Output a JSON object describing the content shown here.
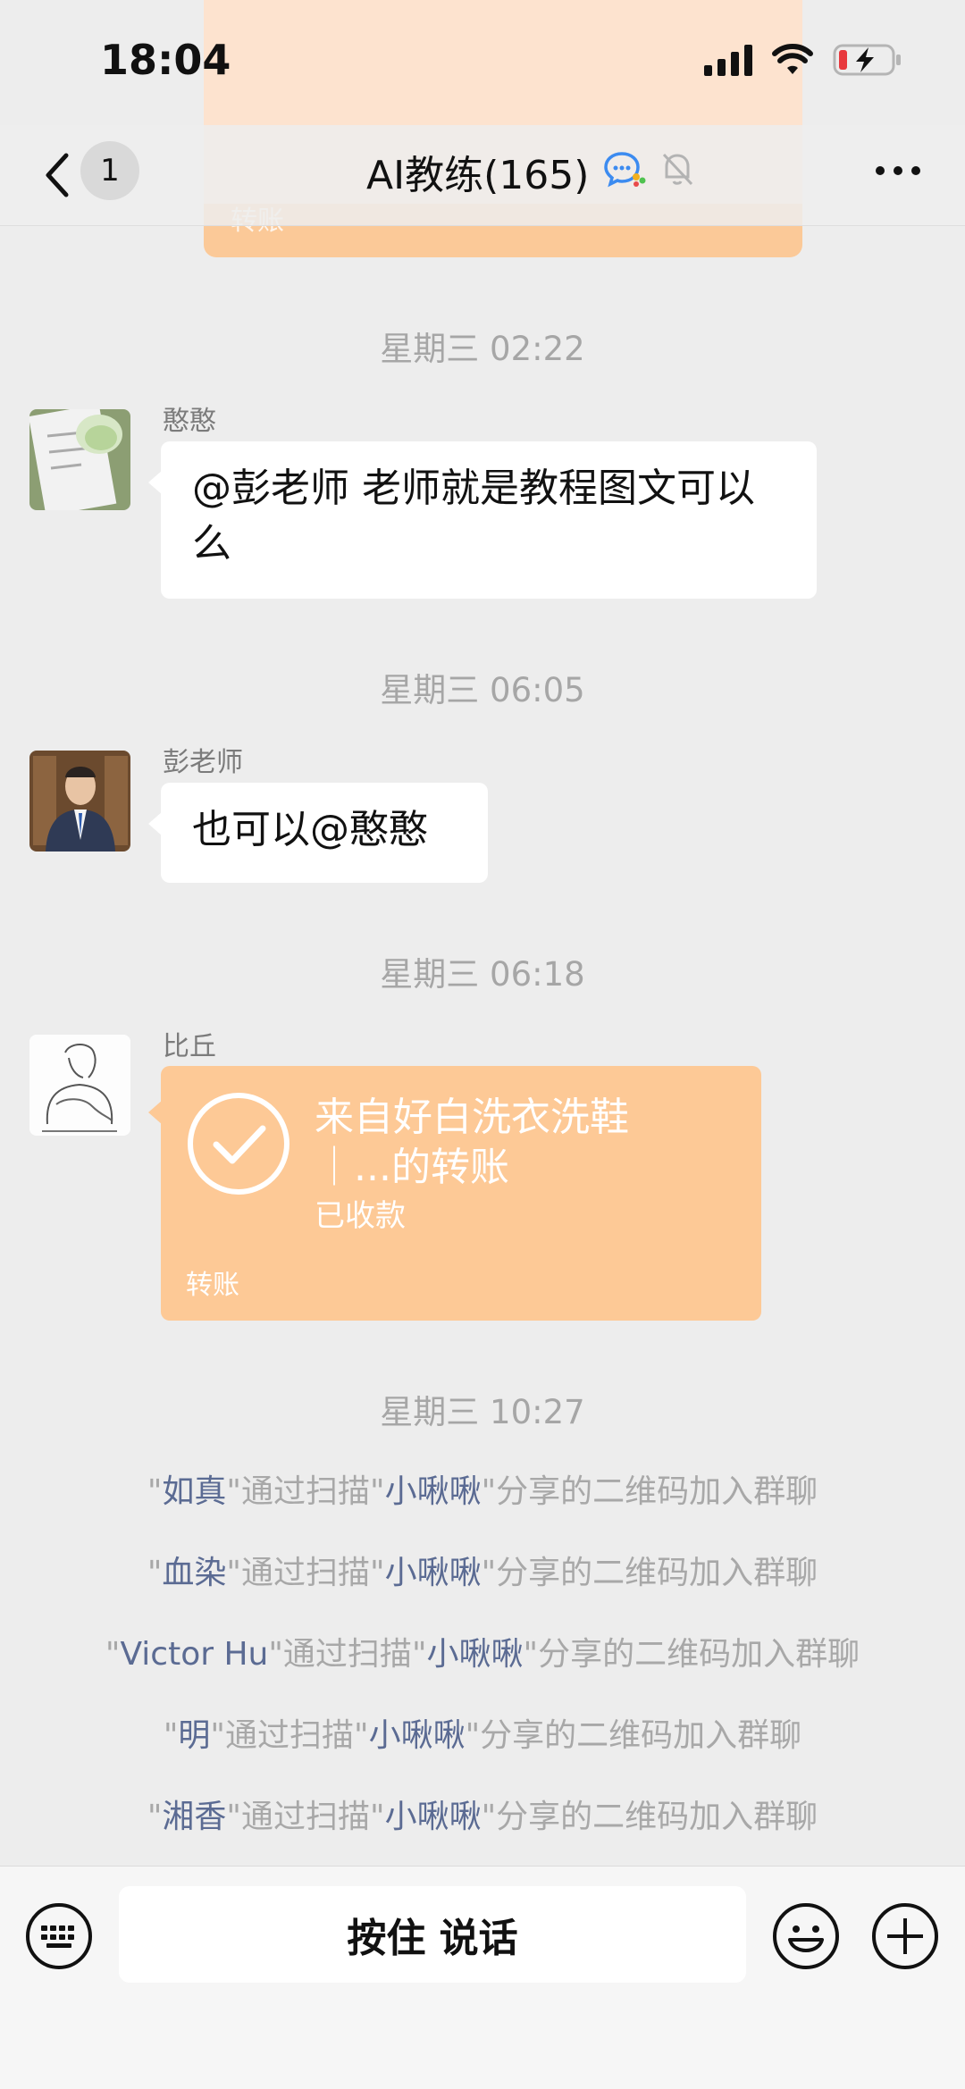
{
  "status_bar": {
    "time": "18:04"
  },
  "header": {
    "back_count": "1",
    "title": "AI教练(165)"
  },
  "background_card_label": "转账",
  "messages": [
    {
      "timestamp": "星期三 02:22",
      "sender": "憨憨",
      "text": "@彭老师 老师就是教程图文可以么"
    },
    {
      "timestamp": "星期三 06:05",
      "sender": "彭老师",
      "text": "也可以@憨憨"
    },
    {
      "timestamp": "星期三 06:18",
      "sender": "比丘",
      "transfer": {
        "title": "来自好白洗衣洗鞋｜...的转账",
        "status": "已收款",
        "label": "转账"
      }
    }
  ],
  "system": {
    "timestamp": "星期三 10:27",
    "events": [
      {
        "member": "如真",
        "inviter": "小啾啾",
        "q": "\"",
        "mid": "通过扫描",
        "tail": "分享的二维码加入群聊"
      },
      {
        "member": "血染",
        "inviter": "小啾啾",
        "q": "\"",
        "mid": "通过扫描",
        "tail": "分享的二维码加入群聊"
      },
      {
        "member": "Victor Hu",
        "inviter": "小啾啾",
        "q": "\"",
        "mid": "通过扫描",
        "tail": "分享的二维码加入群聊"
      },
      {
        "member": "明",
        "inviter": "小啾啾",
        "q": "\"",
        "mid": "通过扫描",
        "tail": "分享的二维码加入群聊"
      },
      {
        "member": "湘香",
        "inviter": "小啾啾",
        "q": "\"",
        "mid": "通过扫描",
        "tail": "分享的二维码加入群聊"
      }
    ]
  },
  "input_bar": {
    "talk_label": "按住 说话"
  },
  "colors": {
    "background": "#ededed",
    "transfer": "#fdc996",
    "link": "#5b6b93"
  }
}
